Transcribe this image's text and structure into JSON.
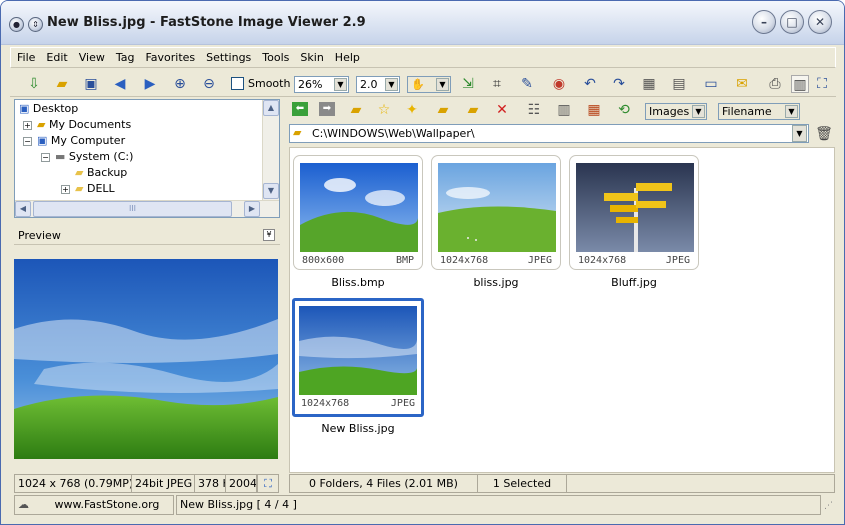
{
  "window": {
    "title": "New Bliss.jpg  -  FastStone Image Viewer 2.9",
    "controls": {
      "minimize": "–",
      "maximize": "□",
      "close": "✕"
    }
  },
  "menu": [
    "File",
    "Edit",
    "View",
    "Tag",
    "Favorites",
    "Settings",
    "Tools",
    "Skin",
    "Help"
  ],
  "toolbar": {
    "smooth_label": "Smooth",
    "zoom_value": "26%",
    "factor_value": "2.0"
  },
  "tree": {
    "items": [
      {
        "label": "Desktop",
        "icon": "desktop-icon"
      },
      {
        "label": "My Documents",
        "icon": "folder-documents-icon"
      },
      {
        "label": "My Computer",
        "icon": "computer-icon"
      },
      {
        "label": "System (C:)",
        "icon": "drive-icon"
      },
      {
        "label": "Backup",
        "icon": "folder-icon"
      },
      {
        "label": "DELL",
        "icon": "folder-icon"
      }
    ],
    "scroll_thumb": "III"
  },
  "preview": {
    "label": "Preview"
  },
  "status_left": {
    "dimensions": "1024 x 768 (0.79MP)",
    "bitdepth": "24bit JPEG",
    "size": "378 KB",
    "year": "2004"
  },
  "browser": {
    "filter_value": "Images",
    "sort_value": "Filename",
    "path": "C:\\WINDOWS\\Web\\Wallpaper\\",
    "thumbs": [
      {
        "name": "Bliss.bmp",
        "dim": "800x600",
        "fmt": "BMP",
        "selected": false
      },
      {
        "name": "bliss.jpg",
        "dim": "1024x768",
        "fmt": "JPEG",
        "selected": false
      },
      {
        "name": "Bluff.jpg",
        "dim": "1024x768",
        "fmt": "JPEG",
        "selected": false
      },
      {
        "name": "New Bliss.jpg",
        "dim": "1024x768",
        "fmt": "JPEG",
        "selected": true
      }
    ]
  },
  "status_right": {
    "summary": "0 Folders, 4 Files (2.01 MB)",
    "selected": "1 Selected"
  },
  "bottom": {
    "website": "www.FastStone.org",
    "current_file": "New Bliss.jpg [ 4 / 4 ]"
  },
  "colors": {
    "accent": "#2b65c6",
    "sky": "#2d6fd0",
    "grass": "#3f9a1e"
  }
}
